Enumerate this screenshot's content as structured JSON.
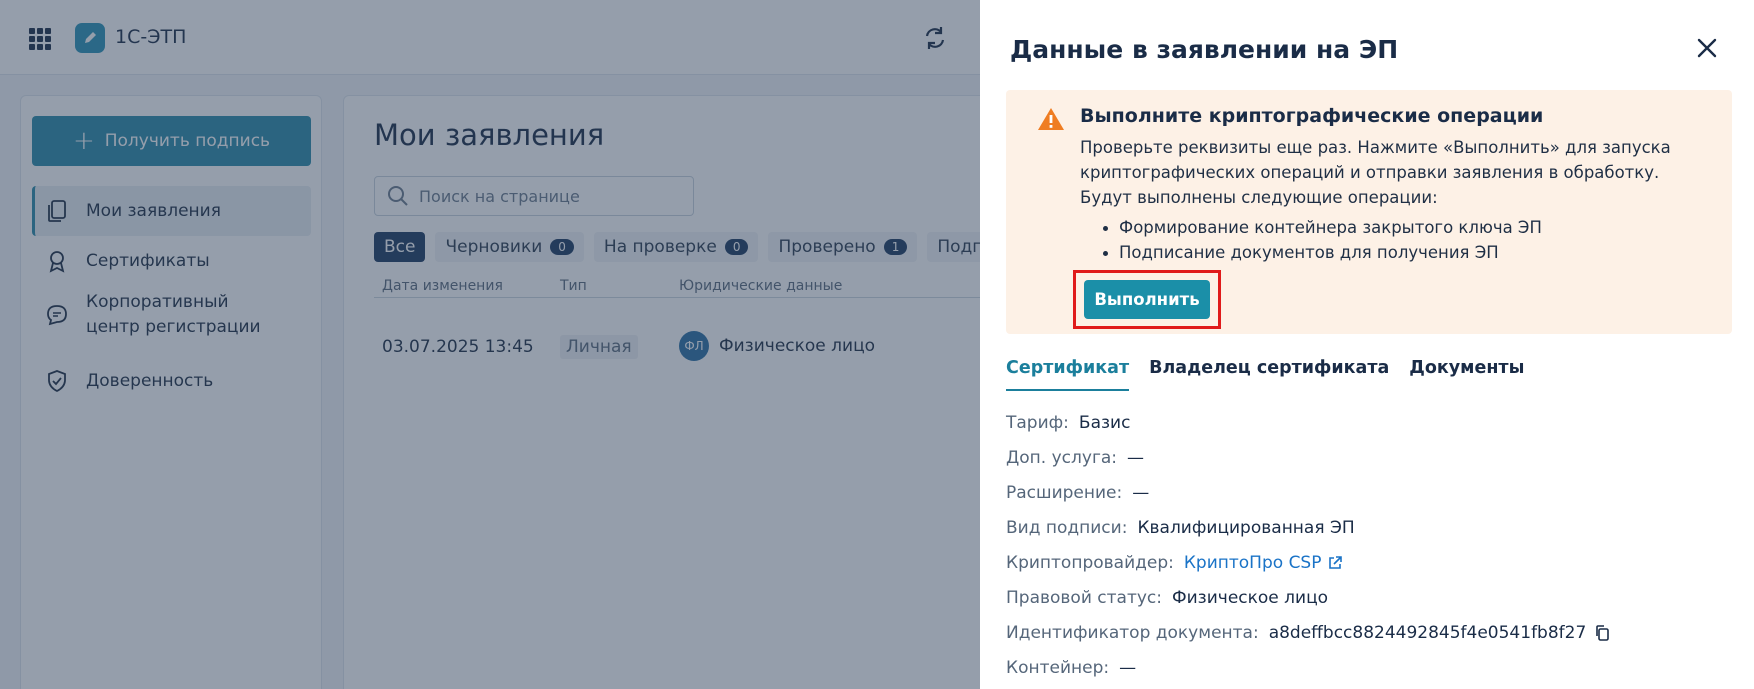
{
  "app": {
    "title": "1С-ЭТП"
  },
  "sidebar": {
    "get_sign_label": "Получить подпись",
    "items": [
      {
        "label": "Мои заявления"
      },
      {
        "label": "Сертификаты"
      },
      {
        "label": "Корпоративный центр регистрации"
      },
      {
        "label": "Доверенность"
      }
    ]
  },
  "main": {
    "title": "Мои заявления",
    "search_placeholder": "Поиск на странице",
    "filters": [
      {
        "label": "Все"
      },
      {
        "label": "Черновики",
        "count": "0"
      },
      {
        "label": "На проверке",
        "count": "0"
      },
      {
        "label": "Проверено",
        "count": "1"
      },
      {
        "label": "Подп"
      }
    ],
    "columns": [
      "Дата изменения",
      "Тип",
      "Юридические данные"
    ],
    "rows": [
      {
        "date": "03.07.2025 13:45",
        "type": "Личная",
        "avatar": "ФЛ",
        "legal": "Физическое лицо"
      }
    ]
  },
  "panel": {
    "title": "Данные в заявлении на ЭП",
    "alert": {
      "title": "Выполните криптографические операции",
      "text_lines": [
        "Проверьте реквизиты еще раз. Нажмите «Выполнить» для запуска",
        "криптографических операций и отправки заявления в обработку.",
        "Будут выполнены следующие операции:"
      ],
      "operations": [
        "Формирование контейнера закрытого ключа ЭП",
        "Подписание документов для получения ЭП"
      ],
      "button_label": "Выполнить"
    },
    "tabs": [
      {
        "label": "Сертификат"
      },
      {
        "label": "Владелец сертификата"
      },
      {
        "label": "Документы"
      }
    ],
    "fields": [
      {
        "key": "Тариф:",
        "value": "Базис"
      },
      {
        "key": "Доп. услуга:",
        "value": "—"
      },
      {
        "key": "Расширение:",
        "value": "—"
      },
      {
        "key": "Вид подписи:",
        "value": "Квалифицированная ЭП"
      },
      {
        "key": "Криптопровайдер:",
        "value": "КриптоПро CSP"
      },
      {
        "key": "Правовой статус:",
        "value": "Физическое лицо"
      },
      {
        "key": "Идентификатор документа:",
        "value": "a8deffbcc8824492845f4e0541fb8f27"
      },
      {
        "key": "Контейнер:",
        "value": "—"
      }
    ]
  },
  "colors": {
    "accent": "#1b8fa8",
    "alert_bg": "#fdf1e6",
    "highlight_border": "#e01b1b",
    "link": "#1a73c7"
  }
}
